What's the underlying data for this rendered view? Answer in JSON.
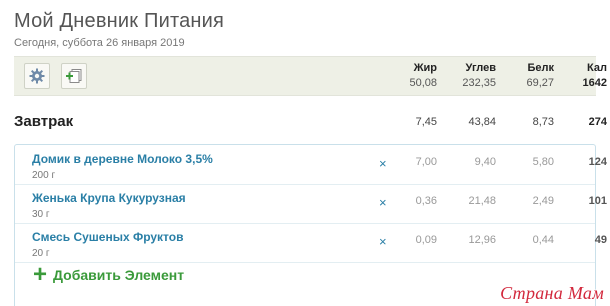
{
  "page": {
    "title": "Мой Дневник Питания",
    "date": "Сегодня, суббота 26 января 2019"
  },
  "toolbar": {
    "settings_icon": "gear-icon",
    "add_icon": "add-copy-icon"
  },
  "columns": {
    "fat": "Жир",
    "carbs": "Углев",
    "protein": "Белк",
    "cal": "Кал"
  },
  "totals": {
    "fat": "50,08",
    "carbs": "232,35",
    "protein": "69,27",
    "cal": "1642"
  },
  "meal": {
    "title": "Завтрак",
    "fat": "7,45",
    "carbs": "43,84",
    "protein": "8,73",
    "cal": "274"
  },
  "items": [
    {
      "name": "Домик в деревне Молоко 3,5%",
      "portion": "200 г",
      "remove": "×",
      "fat": "7,00",
      "carbs": "9,40",
      "protein": "5,80",
      "cal": "124"
    },
    {
      "name": "Женька Крупа Кукурузная",
      "portion": "30 г",
      "remove": "×",
      "fat": "0,36",
      "carbs": "21,48",
      "protein": "2,49",
      "cal": "101"
    },
    {
      "name": "Смесь Сушеных Фруктов",
      "portion": "20 г",
      "remove": "×",
      "fat": "0,09",
      "carbs": "12,96",
      "protein": "0,44",
      "cal": "49"
    }
  ],
  "add_element": {
    "plus": "+",
    "label": "Добавить Элемент"
  },
  "watermark": "Страна Мам",
  "colors": {
    "link": "#2a7fa6",
    "add": "#3a9a3a",
    "summary_bg": "#eef0e6",
    "watermark": "#d2283c"
  }
}
